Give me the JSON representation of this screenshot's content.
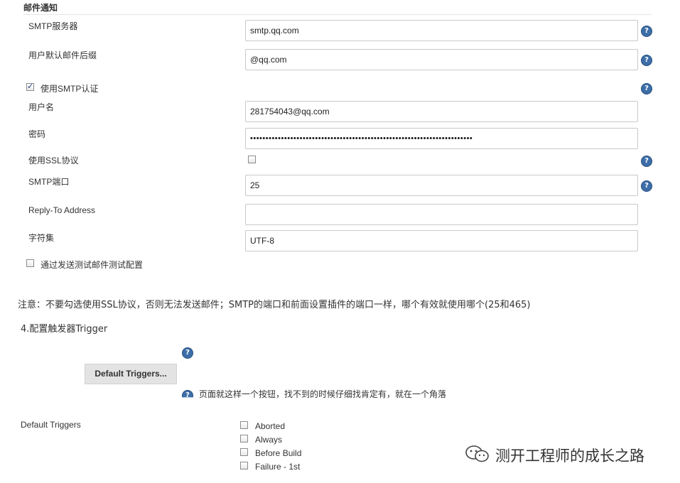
{
  "section": {
    "title": "邮件通知"
  },
  "fields": {
    "smtp_server": {
      "label": "SMTP服务器",
      "value": "smtp.qq.com"
    },
    "default_suffix": {
      "label": "用户默认邮件后缀",
      "value": "@qq.com"
    },
    "use_smtp_auth": {
      "label": "使用SMTP认证",
      "checked": true
    },
    "username": {
      "label": "用户名",
      "value": "281754043@qq.com"
    },
    "password": {
      "label": "密码",
      "value": "••••••••••••••••••••••••••••••••••••••••••••••••••••••••••••••••••••••••"
    },
    "use_ssl": {
      "label": "使用SSL协议",
      "checked": false
    },
    "smtp_port": {
      "label": "SMTP端口",
      "value": "25"
    },
    "reply_to": {
      "label": "Reply-To Address",
      "value": ""
    },
    "charset": {
      "label": "字符集",
      "value": "UTF-8"
    },
    "test_config": {
      "label": "通过发送测试邮件测试配置",
      "checked": false
    }
  },
  "notes": {
    "ssl_warning": "注意：不要勾选使用SSL协议，否则无法发送邮件；SMTP的端口和前面设置插件的端口一样，哪个有效就使用哪个(25和465)",
    "step_heading": "4.配置触发器Trigger",
    "button_hint": "页面就这样一个按钮，找不到的时候仔细找肯定有，就在一个角落"
  },
  "triggers_button": {
    "label": "Default Triggers..."
  },
  "default_triggers": {
    "label": "Default Triggers",
    "items": [
      {
        "label": "Aborted",
        "checked": false
      },
      {
        "label": "Always",
        "checked": false
      },
      {
        "label": "Before Build",
        "checked": false
      },
      {
        "label": "Failure - 1st",
        "checked": false
      }
    ]
  },
  "help_icon_glyph": "?",
  "watermark": {
    "text": "测开工程师的成长之路"
  },
  "icons": {
    "help": "help-icon",
    "checkbox": "checkbox",
    "wechat": "wechat-logo-icon"
  }
}
